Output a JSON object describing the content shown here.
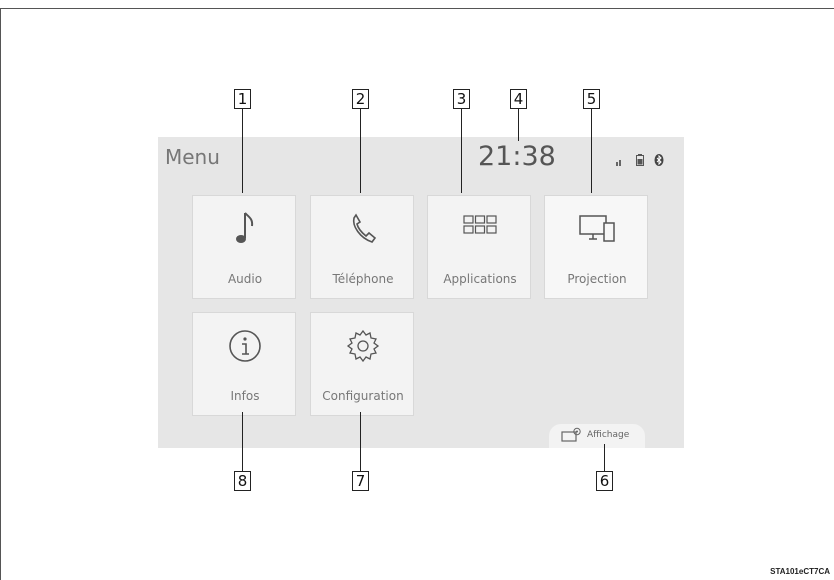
{
  "screen": {
    "title": "Menu",
    "clock": "21:38",
    "status_icons": [
      "signal-icon",
      "battery-icon",
      "bluetooth-icon"
    ]
  },
  "tiles": [
    {
      "label": "Audio",
      "icon": "music-note-icon"
    },
    {
      "label": "Téléphone",
      "icon": "phone-icon"
    },
    {
      "label": "Applications",
      "icon": "grid-icon"
    },
    {
      "label": "Projection",
      "icon": "devices-icon"
    },
    {
      "label": "Infos",
      "icon": "info-icon"
    },
    {
      "label": "Configuration",
      "icon": "gear-icon"
    }
  ],
  "display_button": {
    "label": "Affichage",
    "icon": "display-icon"
  },
  "callouts": [
    "1",
    "2",
    "3",
    "4",
    "5",
    "6",
    "7",
    "8"
  ],
  "figure_code": "STA101eCT7CA"
}
